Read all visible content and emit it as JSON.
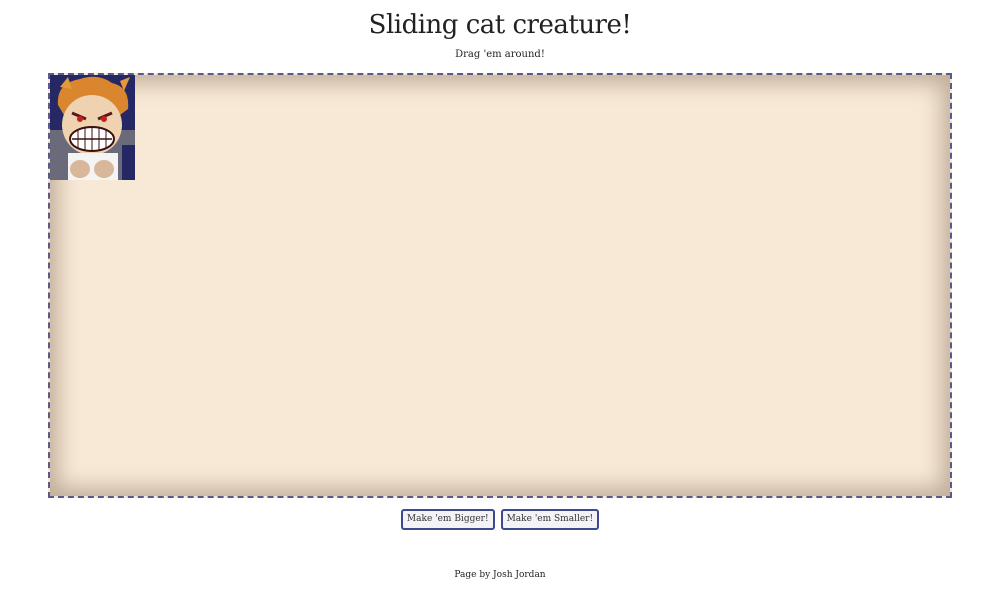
{
  "page": {
    "title": "Sliding cat creature!",
    "subtitle": "Drag 'em around!"
  },
  "arena": {
    "sprite_icon": "grinning-cat-creature-image"
  },
  "controls": {
    "bigger_label": "Make 'em Bigger!",
    "smaller_label": "Make 'em Smaller!"
  },
  "footer": {
    "credit": "Page by Josh Jordan"
  },
  "colors": {
    "arena_background": "#f8e9d6",
    "arena_border": "#5a5a8a",
    "button_border": "#3c4a8c"
  }
}
